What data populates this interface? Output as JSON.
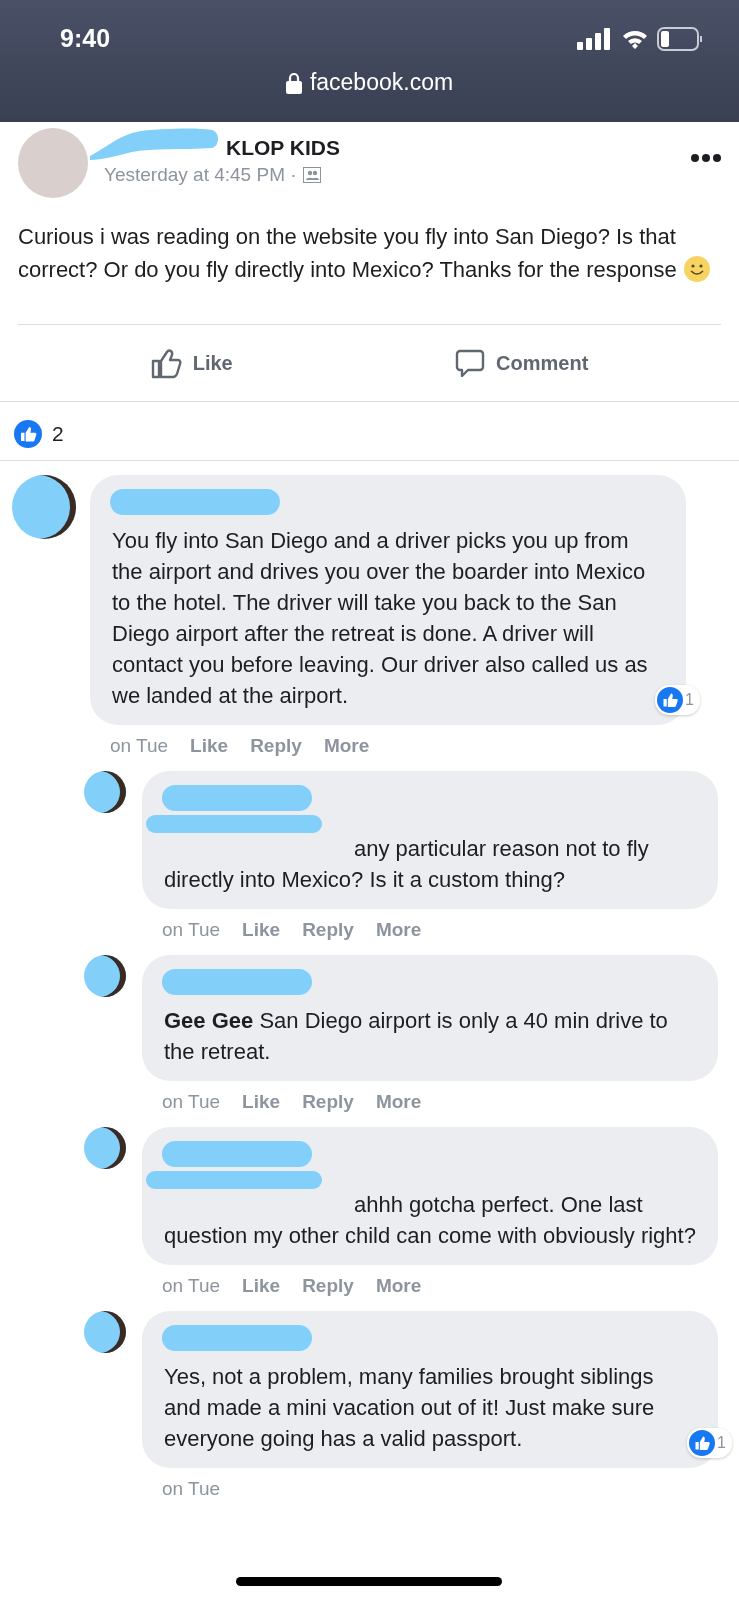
{
  "status_bar": {
    "time": "9:40"
  },
  "browser": {
    "address": "facebook.com"
  },
  "post": {
    "author": "KLOP KIDS",
    "timestamp": "Yesterday at 4:45 PM ·",
    "text": "Curious i was reading on the website you fly into San Diego? Is that correct? Or do you fly directly into Mexico? Thanks for the response",
    "actions": [
      "Like",
      "Comment"
    ],
    "reaction_count": "2"
  },
  "comments": [
    {
      "kind": "top",
      "text": "You fly into San Diego and a driver picks you up from the airport and drives you over the boarder into Mexico to the hotel. The driver will take you back to the San Diego airport after the retreat is done. A driver will contact you before leaving. Our driver also called us as we landed at the airport.",
      "reactions": "1",
      "time": "on Tue",
      "actions": [
        "Like",
        "Reply",
        "More"
      ]
    },
    {
      "kind": "reply",
      "text": "any particular reason not to fly directly into Mexico? Is it a custom thing?",
      "tag_redacted": true,
      "time": "on Tue",
      "actions": [
        "Like",
        "Reply",
        "More"
      ]
    },
    {
      "kind": "reply",
      "text": "**Gee Gee** San Diego airport is only a 40 min drive to the retreat.",
      "tag_redacted": false,
      "time": "on Tue",
      "actions": [
        "Like",
        "Reply",
        "More"
      ]
    },
    {
      "kind": "reply",
      "text": "ahhh gotcha perfect. One last question my other child can come with obviously right?",
      "tag_redacted": true,
      "time": "on Tue",
      "actions": [
        "Like",
        "Reply",
        "More"
      ]
    },
    {
      "kind": "reply",
      "text": "Yes, not a problem, many families brought siblings and made a mini vacation out of it! Just make sure everyone going has a valid passport.",
      "tag_redacted": false,
      "reactions": "1",
      "time": "on Tue"
    }
  ]
}
